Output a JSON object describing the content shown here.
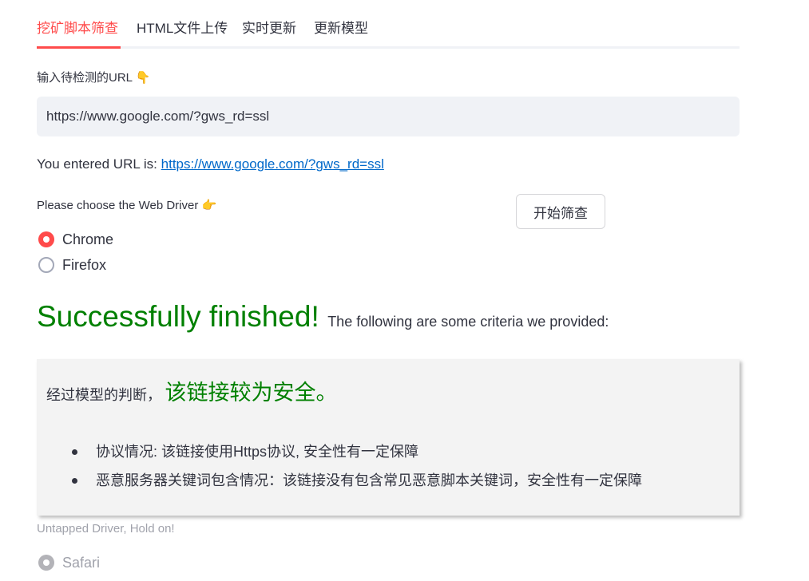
{
  "tabs": [
    {
      "label": "挖矿脚本筛查",
      "active": true
    },
    {
      "label": "HTML文件上传",
      "active": false
    },
    {
      "label": "实时更新",
      "active": false
    },
    {
      "label": "更新模型",
      "active": false
    }
  ],
  "url_section": {
    "label": "输入待检测的URL",
    "label_emoji": "👇",
    "input_value": "https://www.google.com/?gws_rd=ssl",
    "entered_prefix": "You entered URL is:",
    "entered_link": "https://www.google.com/?gws_rd=ssl"
  },
  "driver_section": {
    "label": "Please choose the Web Driver",
    "label_emoji": "👉",
    "options": [
      {
        "label": "Chrome",
        "selected": true
      },
      {
        "label": "Firefox",
        "selected": false
      }
    ],
    "start_button": "开始筛查"
  },
  "result": {
    "title": "Successfully finished!",
    "subtitle": "The following are some criteria we provided:",
    "verdict_prefix": "经过模型的判断，",
    "verdict": "该链接较为安全。",
    "criteria": [
      "协议情况: 该链接使用Https协议, 安全性有一定保障",
      "恶意服务器关键词包含情况：该链接没有包含常见恶意脚本关键词，安全性有一定保障"
    ]
  },
  "untapped": {
    "label": "Untapped Driver, Hold on!",
    "options": [
      {
        "label": "Safari",
        "disabled": true
      }
    ]
  },
  "colors": {
    "accent": "#ff4b4b",
    "success": "#008000",
    "link": "#0068c9",
    "text": "#31333f"
  }
}
